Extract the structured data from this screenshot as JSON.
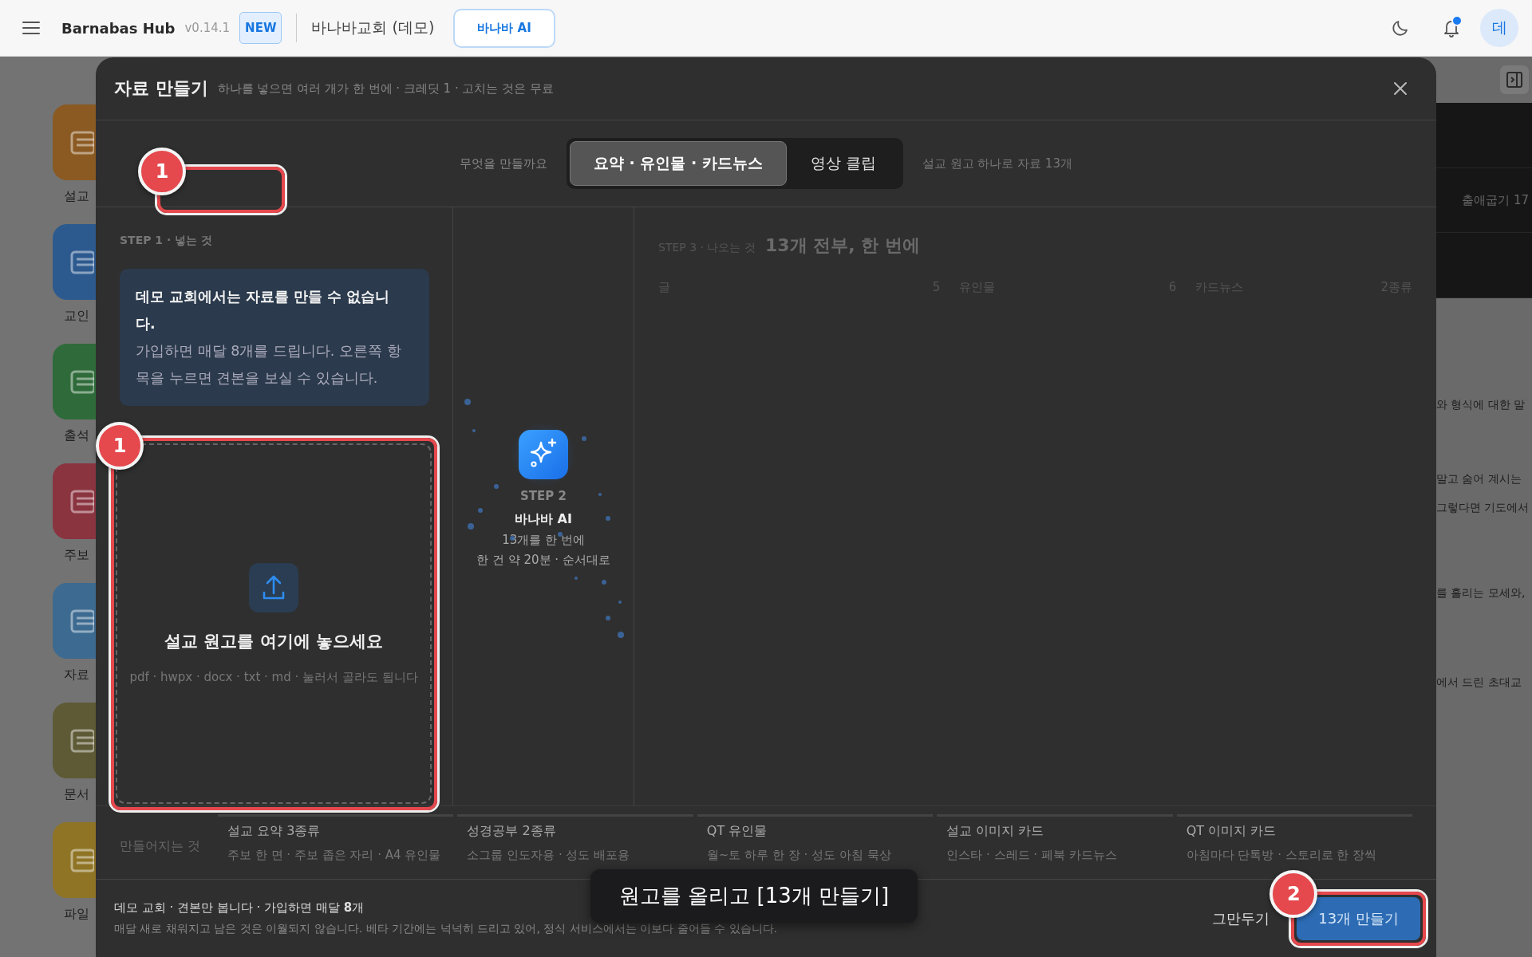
{
  "top_bar": {
    "app_name": "Barnabas Hub",
    "version": "v0.14.1",
    "badge": "NEW",
    "church": "바나바교회 (데모)",
    "ai_button": "바나바 AI",
    "unread": true,
    "avatar": "데"
  },
  "background": {
    "apps": [
      {
        "label": "설교",
        "color": "#8a5a22"
      },
      {
        "label": "교인",
        "color": "#2d5a8e"
      },
      {
        "label": "출석",
        "color": "#2f6b3a"
      },
      {
        "label": "주보",
        "color": "#8a3440"
      },
      {
        "label": "자료",
        "color": "#3d6a90"
      },
      {
        "label": "문서",
        "color": "#5d5a35"
      },
      {
        "label": "파일",
        "color": "#8f7425"
      }
    ],
    "passage": "출애굽기 17",
    "text_lines": [
      "와 형식에 대한 말",
      "말고 숨어 계시는",
      "그렇다면 기도에서",
      "를 흘리는 모세와,",
      "에서 드린 초대교"
    ]
  },
  "modal": {
    "title": "자료 만들기",
    "subtitle": "하나를 넣으면 여러 개가 한 번에 · 크레딧 1 · 고치는 것은 무료",
    "mode_label": "무엇을 만들까요",
    "modes": [
      {
        "label": "요약 · 유인물 · 카드뉴스",
        "selected": true
      },
      {
        "label": "영상 클립",
        "selected": false
      }
    ],
    "mode_note": "설교 원고 하나로 자료 13개",
    "step1": {
      "label": "STEP 1 · 넣는 것",
      "notice_title": "데모 교회에서는 자료를 만들 수 없습니다.",
      "notice_body": "가입하면 매달 8개를 드립니다. 오른쪽 항목을 누르면 견본을 보실 수 있습니다.",
      "drop_title": "설교 원고를 여기에 놓으세요",
      "drop_hint": "pdf · hwpx · docx · txt · md · 눌러서 골라도 됩니다"
    },
    "step2": {
      "label": "STEP 2",
      "name": "바나바 AI",
      "line1": "13개를 한 번에",
      "line2": "한 건 약 20분 · 순서대로"
    },
    "step3": {
      "label": "STEP 3 · 나오는 것",
      "headline": "13개 전부, 한 번에",
      "outputs": [
        {
          "name": "글",
          "count": "5"
        },
        {
          "name": "유인물",
          "count": "6"
        },
        {
          "name": "카드뉴스",
          "count": "2종류"
        }
      ]
    },
    "products_label": "만들어지는 것",
    "products": [
      {
        "title": "설교 요약 3종류",
        "detail": "주보 한 면 · 주보 좁은 자리 · A4 유인물"
      },
      {
        "title": "성경공부 2종류",
        "detail": "소그룹 인도자용 · 성도 배포용"
      },
      {
        "title": "QT 유인물",
        "detail": "월~토 하루 한 장 · 성도 아침 묵상"
      },
      {
        "title": "설교 이미지 카드",
        "detail": "인스타 · 스레드 · 페북 카드뉴스"
      },
      {
        "title": "QT 이미지 카드",
        "detail": "아침마다 단톡방 · 스토리로 한 장씩"
      }
    ],
    "footer": {
      "note": "데모 교회 · 견본만 봅니다 · 가입하면 매달 **8**개",
      "fine_print": "매달 새로 채워지고 남은 것은 이월되지 않습니다. 베타 기간에는 넉넉히 드리고 있어, 정식 서비스에서는 이보다 줄어들 수 있습니다.",
      "cancel": "그만두기",
      "submit": "13개 만들기"
    }
  },
  "tutorial": {
    "marks": [
      {
        "number": "1",
        "kind": "mode_row"
      },
      {
        "number": "1",
        "kind": "dropzone"
      },
      {
        "number": "2",
        "kind": "submit"
      }
    ],
    "tooltip": "원고를 올리고 [13개 만들기]"
  }
}
